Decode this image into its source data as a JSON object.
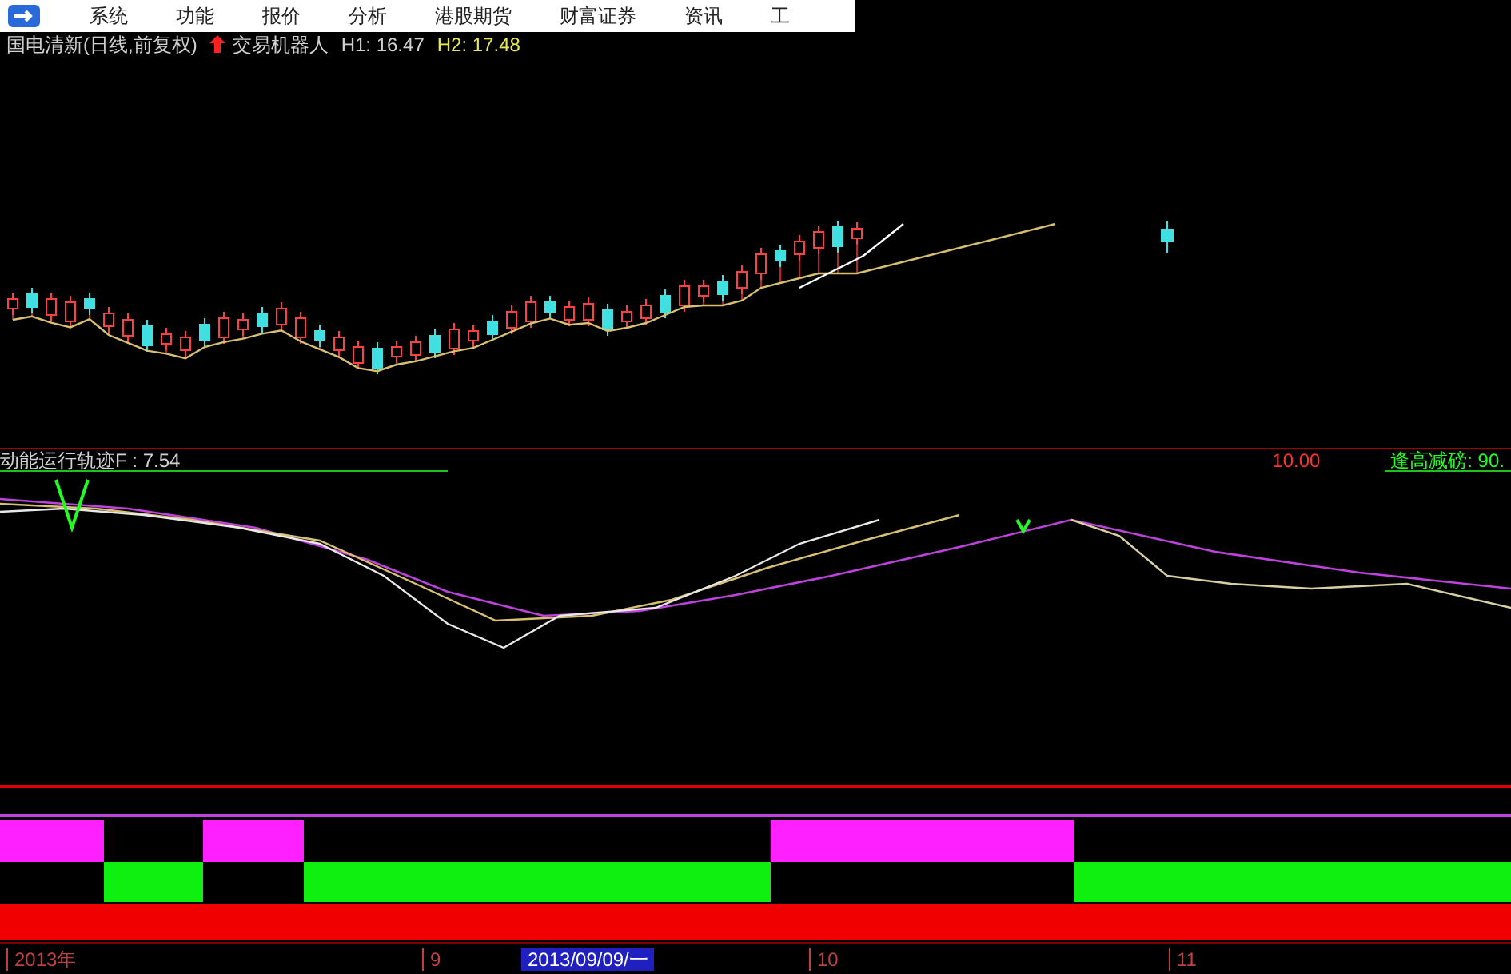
{
  "menu": {
    "items": [
      "系统",
      "功能",
      "报价",
      "分析",
      "港股期货",
      "财富证券",
      "资讯",
      "工"
    ]
  },
  "chart_header": {
    "stock": "国电清新(日线,前复权)",
    "robot": "交易机器人",
    "h1": "H1: 16.47",
    "h2": "H2: 17.48"
  },
  "indicator_header": {
    "name": "动能运行轨迹F : 7.54",
    "value_1": "10.00",
    "value_2": "逢高减磅: 90."
  },
  "time_axis": [
    {
      "label": "2013年",
      "selected": false
    },
    {
      "label": "9",
      "selected": false
    },
    {
      "label": "2013/09/09/一",
      "selected": true
    },
    {
      "label": "10",
      "selected": false
    },
    {
      "label": "11",
      "selected": false
    }
  ]
}
